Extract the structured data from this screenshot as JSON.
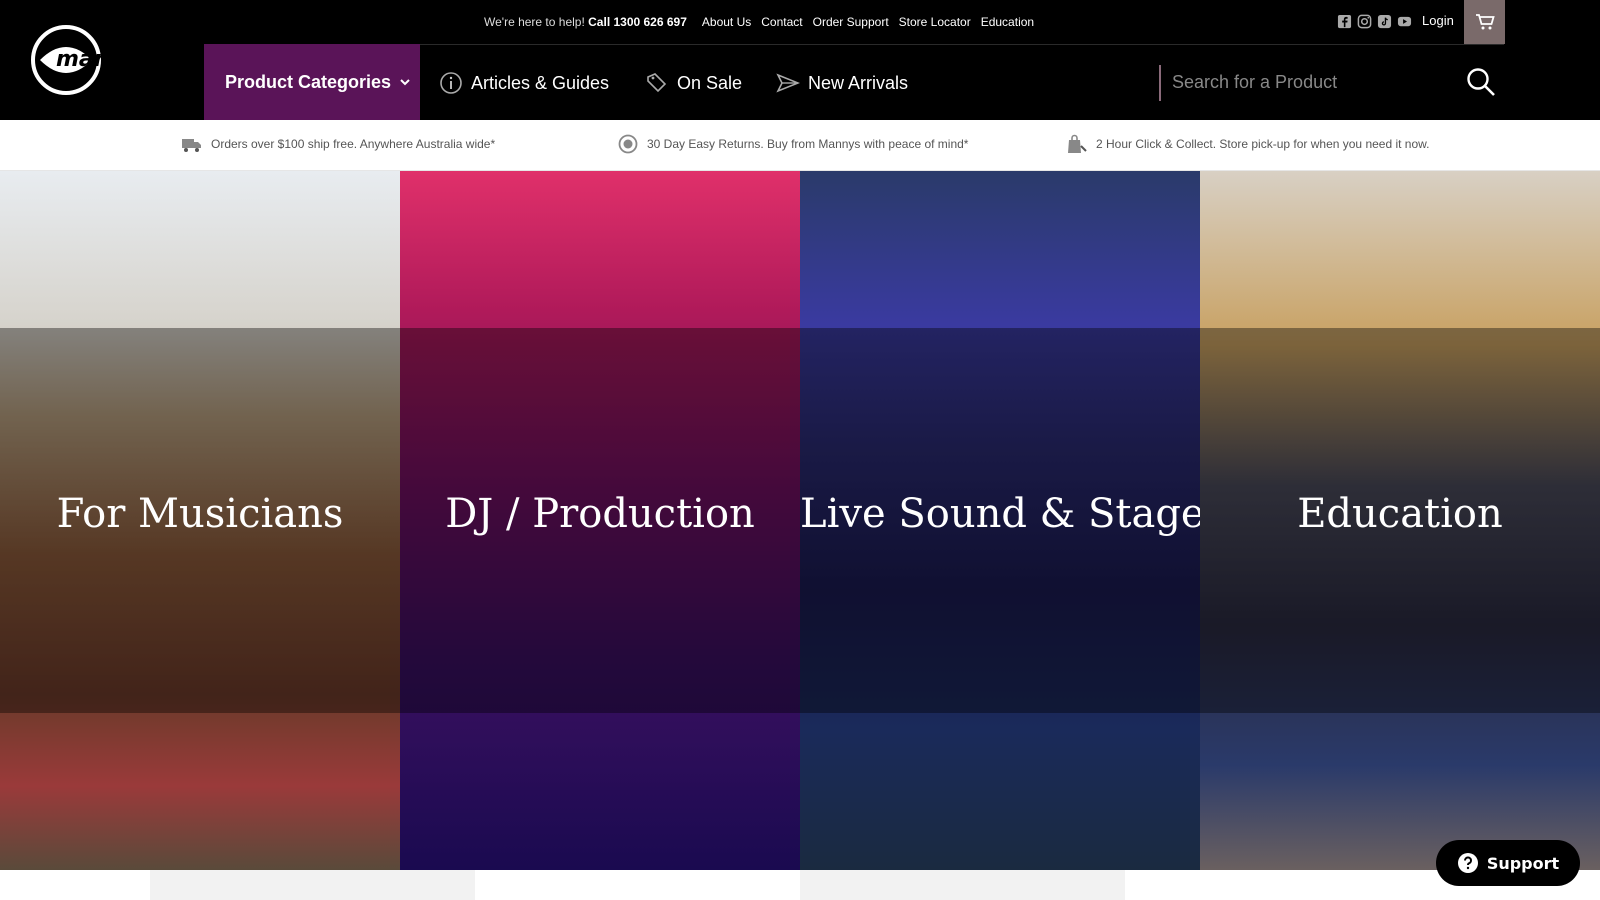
{
  "header": {
    "help_text": "We're here to help!",
    "phone": "Call 1300 626 697",
    "links": [
      "About Us",
      "Contact",
      "Order Support",
      "Store Locator",
      "Education"
    ],
    "login": "Login",
    "logo_text": "mannys"
  },
  "nav": {
    "categories_label": "Product Categories",
    "articles_label": "Articles & Guides",
    "sale_label": "On Sale",
    "arrivals_label": "New Arrivals"
  },
  "search": {
    "placeholder": "Search for a Product"
  },
  "usp": [
    "Orders over $100 ship free. Anywhere Australia wide*",
    "30 Day Easy Returns. Buy from Mannys with peace of mind*",
    "2 Hour Click & Collect. Store pick-up for when you need it now."
  ],
  "tiles": [
    "For Musicians",
    "DJ / Production",
    "Live Sound & Stage",
    "Education"
  ],
  "support_label": "Support",
  "colors": {
    "header_bg": "#000000",
    "category_bg": "#5a1458",
    "cart_bg": "#7a6a6a"
  }
}
